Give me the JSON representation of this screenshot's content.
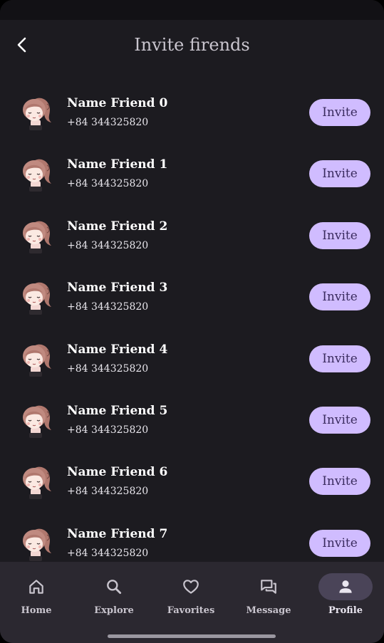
{
  "header": {
    "title": "Invite firends"
  },
  "friends": [
    {
      "name": "Name Friend 0",
      "phone": "+84 344325820",
      "button": "Invite"
    },
    {
      "name": "Name Friend 1",
      "phone": "+84 344325820",
      "button": "Invite"
    },
    {
      "name": "Name Friend 2",
      "phone": "+84 344325820",
      "button": "Invite"
    },
    {
      "name": "Name Friend 3",
      "phone": "+84 344325820",
      "button": "Invite"
    },
    {
      "name": "Name Friend 4",
      "phone": "+84 344325820",
      "button": "Invite"
    },
    {
      "name": "Name Friend 5",
      "phone": "+84 344325820",
      "button": "Invite"
    },
    {
      "name": "Name Friend 6",
      "phone": "+84 344325820",
      "button": "Invite"
    },
    {
      "name": "Name Friend 7",
      "phone": "+84 344325820",
      "button": "Invite"
    }
  ],
  "nav": [
    {
      "label": "Home",
      "icon": "home-icon",
      "active": false
    },
    {
      "label": "Explore",
      "icon": "search-icon",
      "active": false
    },
    {
      "label": "Favorites",
      "icon": "heart-icon",
      "active": false
    },
    {
      "label": "Message",
      "icon": "message-icon",
      "active": false
    },
    {
      "label": "Profile",
      "icon": "person-icon",
      "active": true
    }
  ],
  "colors": {
    "background": "#1c1b20",
    "accent": "#d0bcff",
    "nav_background": "#2b2830",
    "active_pill": "#4a4458"
  }
}
